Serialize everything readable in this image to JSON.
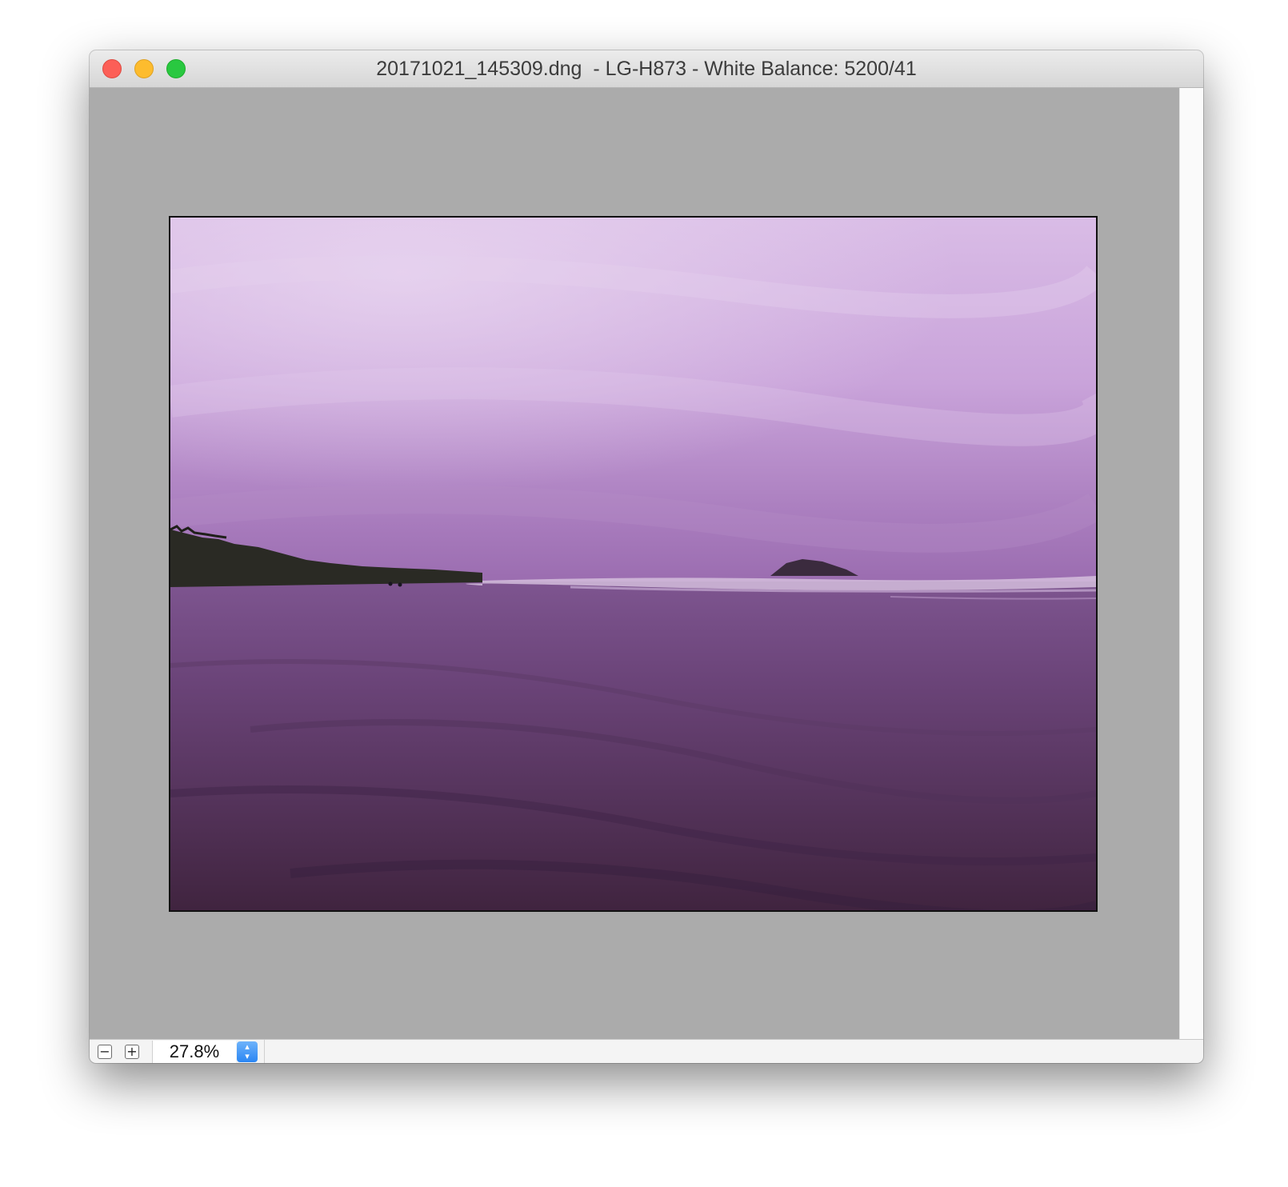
{
  "window": {
    "title": "20171021_145309.dng  - LG-H873 - White Balance: 5200/41"
  },
  "window_controls": {
    "close_color": "#fc5f57",
    "minimize_color": "#fdbc2e",
    "zoom_color": "#29c840"
  },
  "image": {
    "description_icon": "photo-preview"
  },
  "statusbar": {
    "zoom_out_symbol": "−",
    "zoom_in_symbol": "+",
    "zoom_value": "27.8%",
    "stepper_symbol": "⌃⌄"
  }
}
